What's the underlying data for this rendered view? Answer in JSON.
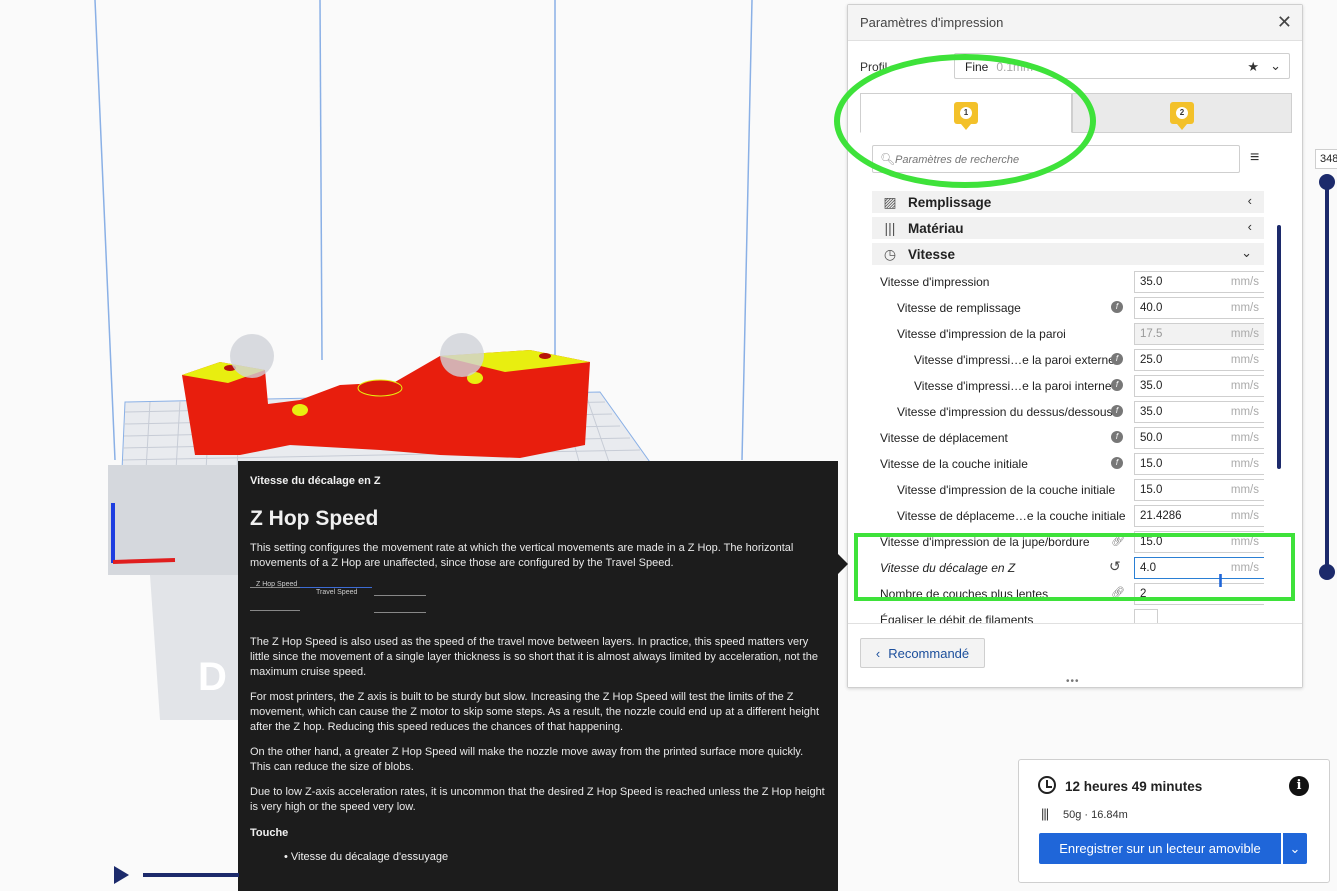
{
  "panel": {
    "title": "Paramètres d'impression",
    "profile_label": "Profil",
    "profile_value": "Fine",
    "profile_sub": "0.1mm",
    "extruders": [
      "1",
      "2"
    ],
    "search_placeholder": "Paramètres de recherche",
    "categories": [
      {
        "name": "Remplissage",
        "icon": "infill-icon",
        "expanded": false
      },
      {
        "name": "Matériau",
        "icon": "material-icon",
        "expanded": false
      },
      {
        "name": "Vitesse",
        "icon": "speed-gauge-icon",
        "expanded": true
      }
    ],
    "settings": [
      {
        "label": "Vitesse d'impression",
        "value": "35.0",
        "unit": "mm/s",
        "indent": 0
      },
      {
        "label": "Vitesse de remplissage",
        "value": "40.0",
        "unit": "mm/s",
        "indent": 1,
        "fx": true
      },
      {
        "label": "Vitesse d'impression de la paroi",
        "value": "17.5",
        "unit": "mm/s",
        "indent": 1,
        "dim": true
      },
      {
        "label": "Vitesse d'impressi…e la paroi externe",
        "value": "25.0",
        "unit": "mm/s",
        "indent": 2,
        "fx": true
      },
      {
        "label": "Vitesse d'impressi…e la paroi interne",
        "value": "35.0",
        "unit": "mm/s",
        "indent": 2,
        "fx": true
      },
      {
        "label": "Vitesse d'impression du dessus/dessous",
        "value": "35.0",
        "unit": "mm/s",
        "indent": 1,
        "fx": true
      },
      {
        "label": "Vitesse de déplacement",
        "value": "50.0",
        "unit": "mm/s",
        "indent": 0,
        "fx": true
      },
      {
        "label": "Vitesse de la couche initiale",
        "value": "15.0",
        "unit": "mm/s",
        "indent": 0,
        "fx": true
      },
      {
        "label": "Vitesse d'impression de la couche initiale",
        "value": "15.0",
        "unit": "mm/s",
        "indent": 1
      },
      {
        "label": "Vitesse de déplaceme…e la couche initiale",
        "value": "21.4286",
        "unit": "mm/s",
        "indent": 1
      },
      {
        "label": "Vitesse d'impression de la jupe/bordure",
        "value": "15.0",
        "unit": "mm/s",
        "indent": 0,
        "link": true
      },
      {
        "label": "Vitesse du décalage en Z",
        "value": "4.0",
        "unit": "mm/s",
        "indent": 0,
        "italic": true,
        "reset": true,
        "active": true
      },
      {
        "label": "Nombre de couches plus lentes",
        "value": "2",
        "unit": "",
        "indent": 0,
        "link": true
      },
      {
        "label": "Égaliser le débit de filaments",
        "value": "",
        "unit": "",
        "indent": 0,
        "checkbox": true
      }
    ],
    "recommended_label": "Recommandé"
  },
  "layer_slider": {
    "value": "348"
  },
  "tooltip": {
    "title": "Vitesse du décalage en Z",
    "heading": "Z Hop Speed",
    "p1": "This setting configures the movement rate at which the vertical movements are made in a Z Hop. The horizontal movements of a Z Hop are unaffected, since those are configured by the Travel Speed.",
    "diagram_label_1": "Z Hop Speed",
    "diagram_label_2": "Travel Speed",
    "p2": "The Z Hop Speed is also used as the speed of the travel move between layers. In practice, this speed matters very little since the movement of a single layer thickness is so short that it is almost always limited by acceleration, not the maximum cruise speed.",
    "p3": "For most printers, the Z axis is built to be sturdy but slow. Increasing the Z Hop Speed will test the limits of the Z movement, which can cause the Z motor to skip some steps. As a result, the nozzle could end up at a different height after the Z hop. Reducing this speed reduces the chances of that happening.",
    "p4": "On the other hand, a greater Z Hop Speed will make the nozzle move away from the printed surface more quickly. This can reduce the size of blobs.",
    "p5": "Due to low Z-axis acceleration rates, it is uncommon that the desired Z Hop Speed is reached unless the Z Hop height is very high or the speed very low.",
    "affects_label": "Touche",
    "affects_item": "• Vitesse du décalage d'essuyage"
  },
  "print_info": {
    "time": "12 heures 49 minutes",
    "material": "50g · 16.84m",
    "save_label": "Enregistrer sur un lecteur amovible"
  },
  "colors": {
    "accent": "#1f66d9",
    "navy": "#1c2a6b",
    "highlight": "#3ee23a",
    "model": "#e81e0d",
    "badge": "#f3c12a"
  }
}
